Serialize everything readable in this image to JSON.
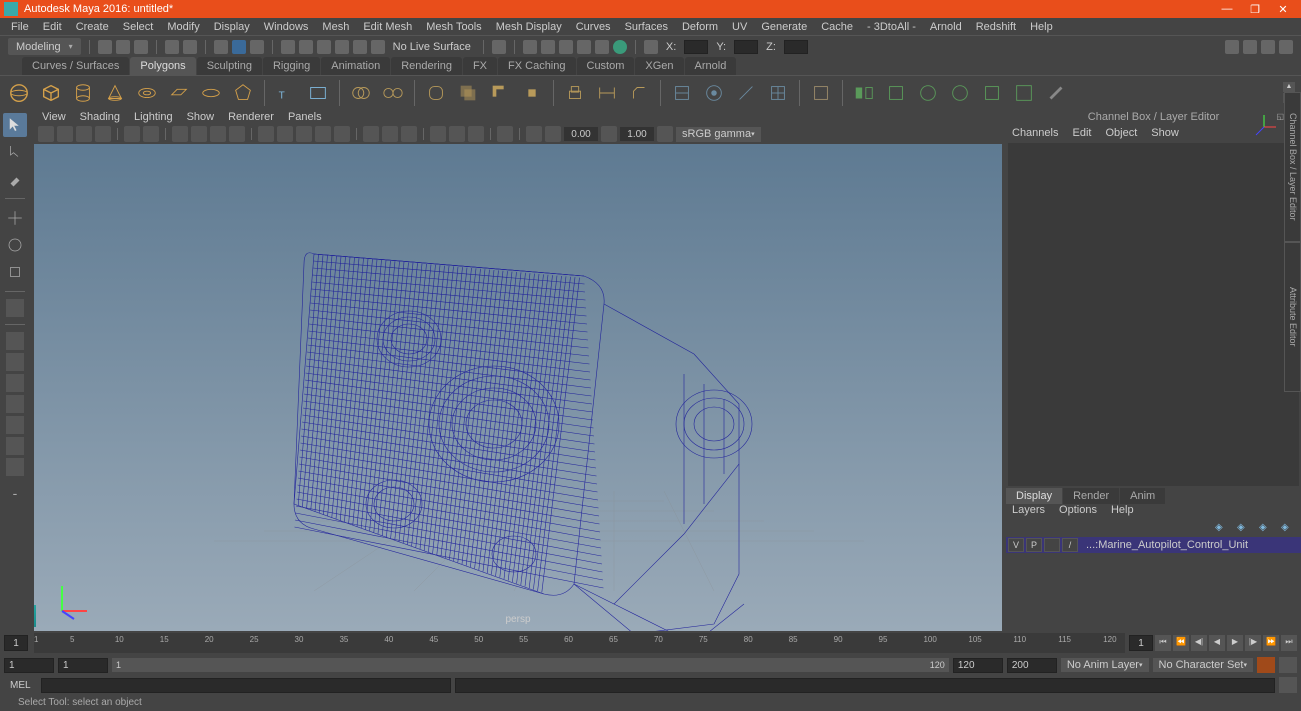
{
  "title": "Autodesk Maya 2016: untitled*",
  "menus": [
    "File",
    "Edit",
    "Create",
    "Select",
    "Modify",
    "Display",
    "Windows",
    "Mesh",
    "Edit Mesh",
    "Mesh Tools",
    "Mesh Display",
    "Curves",
    "Surfaces",
    "Deform",
    "UV",
    "Generate",
    "Cache",
    "- 3DtoAll -",
    "Arnold",
    "Redshift",
    "Help"
  ],
  "workspace_dropdown": "Modeling",
  "status": {
    "liveSurface": "No Live Surface",
    "sym": "",
    "x": "X:",
    "y": "Y:",
    "z": "Z:"
  },
  "shelf_tabs": [
    "Curves / Surfaces",
    "Polygons",
    "Sculpting",
    "Rigging",
    "Animation",
    "Rendering",
    "FX",
    "FX Caching",
    "Custom",
    "XGen",
    "Arnold"
  ],
  "shelf_active": 1,
  "viewport_menus": [
    "View",
    "Shading",
    "Lighting",
    "Show",
    "Renderer",
    "Panels"
  ],
  "viewport_toolbar": {
    "value1": "0.00",
    "value2": "1.00",
    "gamma": "sRGB gamma"
  },
  "viewport_label": "persp",
  "channel_box": {
    "title": "Channel Box / Layer Editor",
    "menus": [
      "Channels",
      "Edit",
      "Object",
      "Show"
    ]
  },
  "layer_tabs": [
    "Display",
    "Render",
    "Anim"
  ],
  "layer_active": 0,
  "layer_menus": [
    "Layers",
    "Options",
    "Help"
  ],
  "layer_row": {
    "v": "V",
    "p": "P",
    "slash": "/",
    "name": "...:Marine_Autopilot_Control_Unit"
  },
  "edge_tabs": [
    "Channel Box / Layer Editor",
    "Attribute Editor"
  ],
  "timeline": {
    "start": 1,
    "ticks": [
      1,
      5,
      10,
      15,
      20,
      25,
      30,
      35,
      40,
      45,
      50,
      55,
      60,
      65,
      70,
      75,
      80,
      85,
      90,
      95,
      100,
      105,
      110,
      115,
      120
    ],
    "current": 1
  },
  "range": {
    "start": "1",
    "inner_start": "1",
    "inner_end": "120",
    "end": "120",
    "end2": "200",
    "animlayer": "No Anim Layer",
    "charset": "No Character Set"
  },
  "cmd": {
    "lang": "MEL"
  },
  "help": "Select Tool: select an object",
  "chart_data": null
}
